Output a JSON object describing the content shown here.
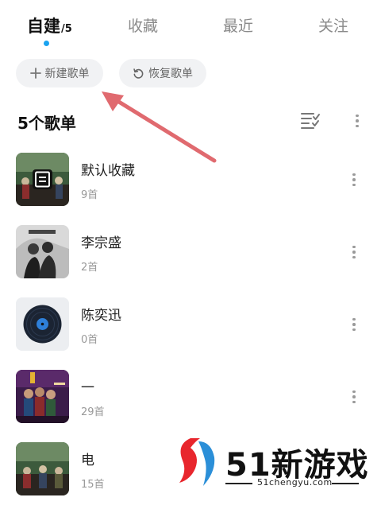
{
  "tabs": [
    {
      "label": "自建",
      "count": "/5"
    },
    {
      "label": "收藏"
    },
    {
      "label": "最近"
    },
    {
      "label": "关注"
    }
  ],
  "actions": {
    "new_playlist": "新建歌单",
    "restore_playlist": "恢复歌单"
  },
  "section": {
    "title": "5个歌单"
  },
  "playlists": [
    {
      "name": "默认收藏",
      "count": "9首"
    },
    {
      "name": "李宗盛",
      "count": "2首"
    },
    {
      "name": "陈奕迅",
      "count": "0首"
    },
    {
      "name": "一",
      "count": "29首"
    },
    {
      "name": "电",
      "count": "15首"
    }
  ],
  "watermark": {
    "brand": "51新游戏",
    "url": "51chengyu.com"
  },
  "colors": {
    "accent": "#1aa3f0",
    "arrow": "#e06a6f"
  }
}
